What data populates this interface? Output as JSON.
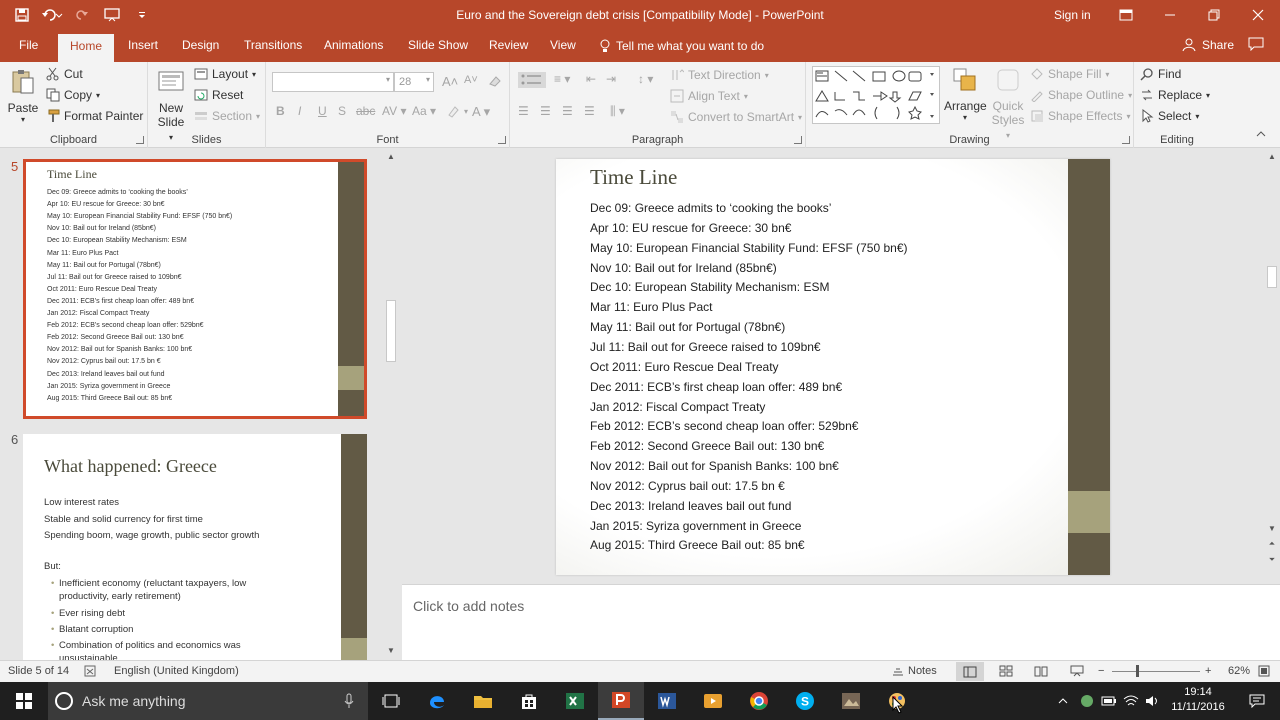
{
  "window": {
    "title": "Euro and the Sovereign debt crisis [Compatibility Mode] - PowerPoint",
    "sign_in": "Sign in"
  },
  "tabs": [
    {
      "label": "File"
    },
    {
      "label": "Home"
    },
    {
      "label": "Insert"
    },
    {
      "label": "Design"
    },
    {
      "label": "Transitions"
    },
    {
      "label": "Animations"
    },
    {
      "label": "Slide Show"
    },
    {
      "label": "Review"
    },
    {
      "label": "View"
    }
  ],
  "tell_me": "Tell me what you want to do",
  "share": "Share",
  "ribbon": {
    "clipboard": {
      "label": "Clipboard",
      "paste": "Paste",
      "cut": "Cut",
      "copy": "Copy",
      "format_painter": "Format Painter"
    },
    "slides": {
      "label": "Slides",
      "new_slide_1": "New",
      "new_slide_2": "Slide",
      "layout": "Layout",
      "reset": "Reset",
      "section": "Section"
    },
    "font": {
      "label": "Font",
      "size": "28"
    },
    "paragraph": {
      "label": "Paragraph",
      "text_direction": "Text Direction",
      "align_text": "Align Text",
      "convert_smartart": "Convert to SmartArt"
    },
    "drawing": {
      "label": "Drawing",
      "arrange": "Arrange",
      "quick_styles_1": "Quick",
      "quick_styles_2": "Styles",
      "shape_fill": "Shape Fill",
      "shape_outline": "Shape Outline",
      "shape_effects": "Shape Effects"
    },
    "editing": {
      "label": "Editing",
      "find": "Find",
      "replace": "Replace",
      "select": "Select"
    }
  },
  "thumbnails": [
    {
      "number": "5",
      "title": "Time Line",
      "lines": [
        "Dec 09: Greece admits to ‘cooking the books’",
        "Apr 10: EU rescue for Greece: 30 bn€",
        "May 10: European Financial Stability Fund: EFSF (750 bn€)",
        "Nov 10: Bail out for Ireland (85bn€)",
        "Dec 10: European Stability Mechanism: ESM",
        "Mar 11: Euro Plus Pact",
        "May 11: Bail out for Portugal (78bn€)",
        "Jul 11: Bail out for Greece raised to 109bn€",
        "Oct 2011: Euro Rescue Deal Treaty",
        "Dec 2011: ECB’s first cheap loan offer: 489 bn€",
        "Jan 2012: Fiscal Compact Treaty",
        "Feb 2012: ECB’s second cheap loan offer: 529bn€",
        "Feb 2012: Second Greece Bail out: 130 bn€",
        "Nov 2012: Bail out for Spanish Banks: 100 bn€",
        "Nov 2012: Cyprus bail out: 17.5 bn €",
        "Dec 2013: Ireland leaves bail out fund",
        "Jan 2015: Syriza government in Greece",
        "Aug 2015: Third Greece Bail out: 85 bn€"
      ]
    },
    {
      "number": "6",
      "title": "What happened: Greece",
      "lines": [
        "Low interest rates",
        "Stable and solid currency for first time",
        "Spending boom, wage growth, public sector growth",
        "But:"
      ],
      "bullets": [
        "Inefficient economy (reluctant taxpayers, low",
        "productivity, early retirement)",
        "Ever rising debt",
        "Blatant corruption",
        "Combination of politics and economics was",
        "unsustainable"
      ]
    }
  ],
  "slide": {
    "title": "Time Line",
    "lines": [
      "Dec 09: Greece admits to ‘cooking the books’",
      "Apr 10: EU rescue for Greece: 30 bn€",
      "May 10: European Financial Stability Fund: EFSF (750 bn€)",
      "Nov 10: Bail out for Ireland (85bn€)",
      "Dec 10: European Stability Mechanism: ESM",
      "Mar 11: Euro Plus Pact",
      "May 11: Bail out for Portugal (78bn€)",
      "Jul 11: Bail out for Greece raised to 109bn€",
      "Oct 2011: Euro Rescue Deal Treaty",
      "Dec 2011: ECB’s first cheap loan offer: 489 bn€",
      "Jan 2012: Fiscal Compact Treaty",
      "Feb 2012: ECB’s second cheap loan offer: 529bn€",
      "Feb 2012: Second Greece Bail out: 130 bn€",
      "Nov 2012: Bail out for Spanish Banks: 100 bn€",
      "Nov 2012: Cyprus bail out: 17.5 bn €",
      "Dec 2013: Ireland leaves bail out fund",
      "Jan 2015: Syriza government in Greece",
      "Aug 2015: Third Greece Bail out: 85 bn€"
    ]
  },
  "notes_placeholder": "Click to add notes",
  "status": {
    "slide_info": "Slide 5 of 14",
    "language": "English (United Kingdom)",
    "notes": "Notes",
    "zoom": "62%"
  },
  "taskbar": {
    "search_placeholder": "Ask me anything",
    "time": "19:14",
    "date": "11/11/2016"
  },
  "colors": {
    "accent": "#b7472a",
    "slide_bar": "#625a45",
    "slide_band": "#a6a27c"
  }
}
